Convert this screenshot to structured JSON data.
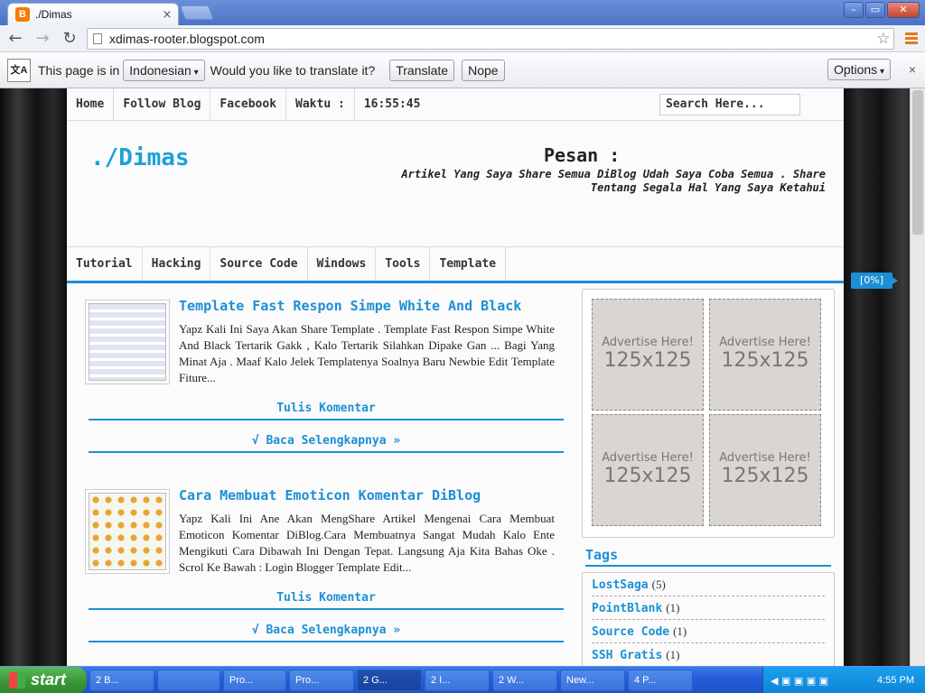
{
  "browser": {
    "tab_title": "./Dimas",
    "tab_icon": "B",
    "tab_close": "×",
    "url": "xdimas-rooter.blogspot.com",
    "star": "☆",
    "back": "←",
    "forward": "→",
    "reload": "↻",
    "win_min": "–",
    "win_max": "▭",
    "win_close": "✕"
  },
  "translate_bar": {
    "icon": "文A",
    "text1": "This page is in",
    "language": "Indonesian",
    "text2": "Would you like to translate it?",
    "translate": "Translate",
    "nope": "Nope",
    "options": "Options",
    "close": "×"
  },
  "page": {
    "percent": "[0%]",
    "topnav": {
      "home": "Home",
      "follow": "Follow Blog",
      "facebook": "Facebook",
      "waktu": "Waktu :",
      "time": "16:55:45"
    },
    "search_placeholder": "Search Here...",
    "site_title": "./Dimas",
    "pesan_title": "Pesan :",
    "pesan_text": "Artikel Yang Saya Share Semua DiBlog Udah Saya Coba Semua . Share Tentang Segala Hal Yang Saya Ketahui",
    "categories": [
      "Tutorial",
      "Hacking",
      "Source Code",
      "Windows",
      "Tools",
      "Template"
    ],
    "posts": [
      {
        "title": "Template Fast Respon Simpe White And Black",
        "body": "Yapz Kali Ini Saya Akan Share Template . Template Fast Respon Simpe White And Black Tertarik Gakk , Kalo Tertarik Silahkan Dipake Gan ... Bagi Yang Minat Aja . Maaf Kalo Jelek Templatenya Soalnya Baru Newbie Edit Template Fiture...",
        "comment": "Tulis Komentar",
        "readmore": "√ Baca Selengkapnya »"
      },
      {
        "title": "Cara Membuat Emoticon Komentar DiBlog",
        "body": "Yapz Kali Ini Ane Akan MengShare Artikel Mengenai Cara Membuat Emoticon Komentar DiBlog.Cara Membuatnya Sangat Mudah Kalo Ente Mengikuti Cara Dibawah Ini Dengan Tepat. Langsung Aja Kita Bahas Oke . Scrol Ke Bawah : Login Blogger Template Edit...",
        "comment": "Tulis Komentar",
        "readmore": "√ Baca Selengkapnya »"
      }
    ],
    "ads": [
      {
        "line1": "Advertise Here!",
        "line2": "125x125"
      },
      {
        "line1": "Advertise Here!",
        "line2": "125x125"
      },
      {
        "line1": "Advertise Here!",
        "line2": "125x125"
      },
      {
        "line1": "Advertise Here!",
        "line2": "125x125"
      }
    ],
    "tags_title": "Tags",
    "tags": [
      {
        "name": "LostSaga",
        "count": "(5)"
      },
      {
        "name": "PointBlank",
        "count": "(1)"
      },
      {
        "name": "Source Code",
        "count": "(1)"
      },
      {
        "name": "SSH Gratis",
        "count": "(1)"
      }
    ]
  },
  "taskbar": {
    "start": "start",
    "tasks": [
      "2 B...",
      "",
      "Pro...",
      "Pro...",
      "2 G...",
      "2 I...",
      "2 W...",
      "New...",
      "4 P..."
    ],
    "clock": "4:55 PM"
  },
  "colors": {
    "accent": "#1c8fd6",
    "site_title": "#1ea0d8"
  }
}
